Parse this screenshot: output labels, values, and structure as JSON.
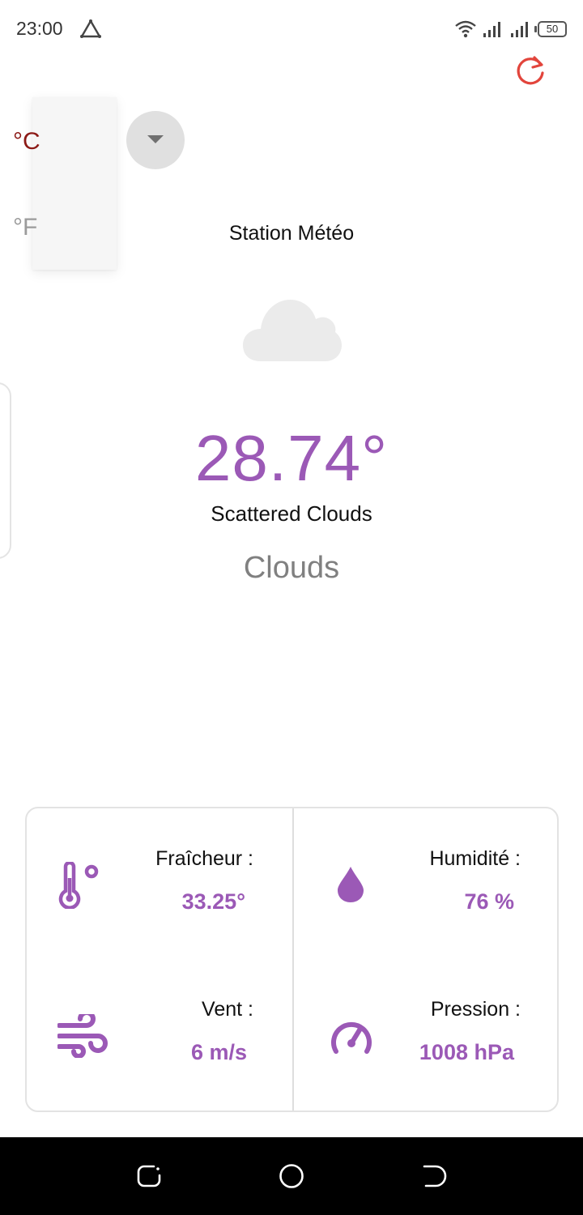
{
  "status_bar": {
    "time": "23:00",
    "battery": "50",
    "icons": [
      "alert-triangle-icon",
      "wifi-icon",
      "signal-icon",
      "signal-icon",
      "battery-icon"
    ]
  },
  "unit_menu": {
    "options": [
      "°C",
      "°F"
    ],
    "selected": "°C"
  },
  "station": {
    "title": "Station Météo"
  },
  "current": {
    "icon": "cloud-icon",
    "temperature": "28.74°",
    "description": "Scattered Clouds",
    "main": "Clouds"
  },
  "details": {
    "feels_like": {
      "label": "Fraîcheur :",
      "value": "33.25°",
      "icon": "thermometer-icon"
    },
    "humidity": {
      "label": "Humidité :",
      "value": "76 %",
      "icon": "water-drop-icon"
    },
    "wind": {
      "label": "Vent :",
      "value": "6 m/s",
      "icon": "wind-icon"
    },
    "pressure": {
      "label": "Pression :",
      "value": "1008 hPa",
      "icon": "gauge-icon"
    }
  },
  "colors": {
    "accent": "#9b59b6",
    "selected_unit": "#8c1a16",
    "refresh": "#e2453c",
    "muted": "#808080"
  }
}
